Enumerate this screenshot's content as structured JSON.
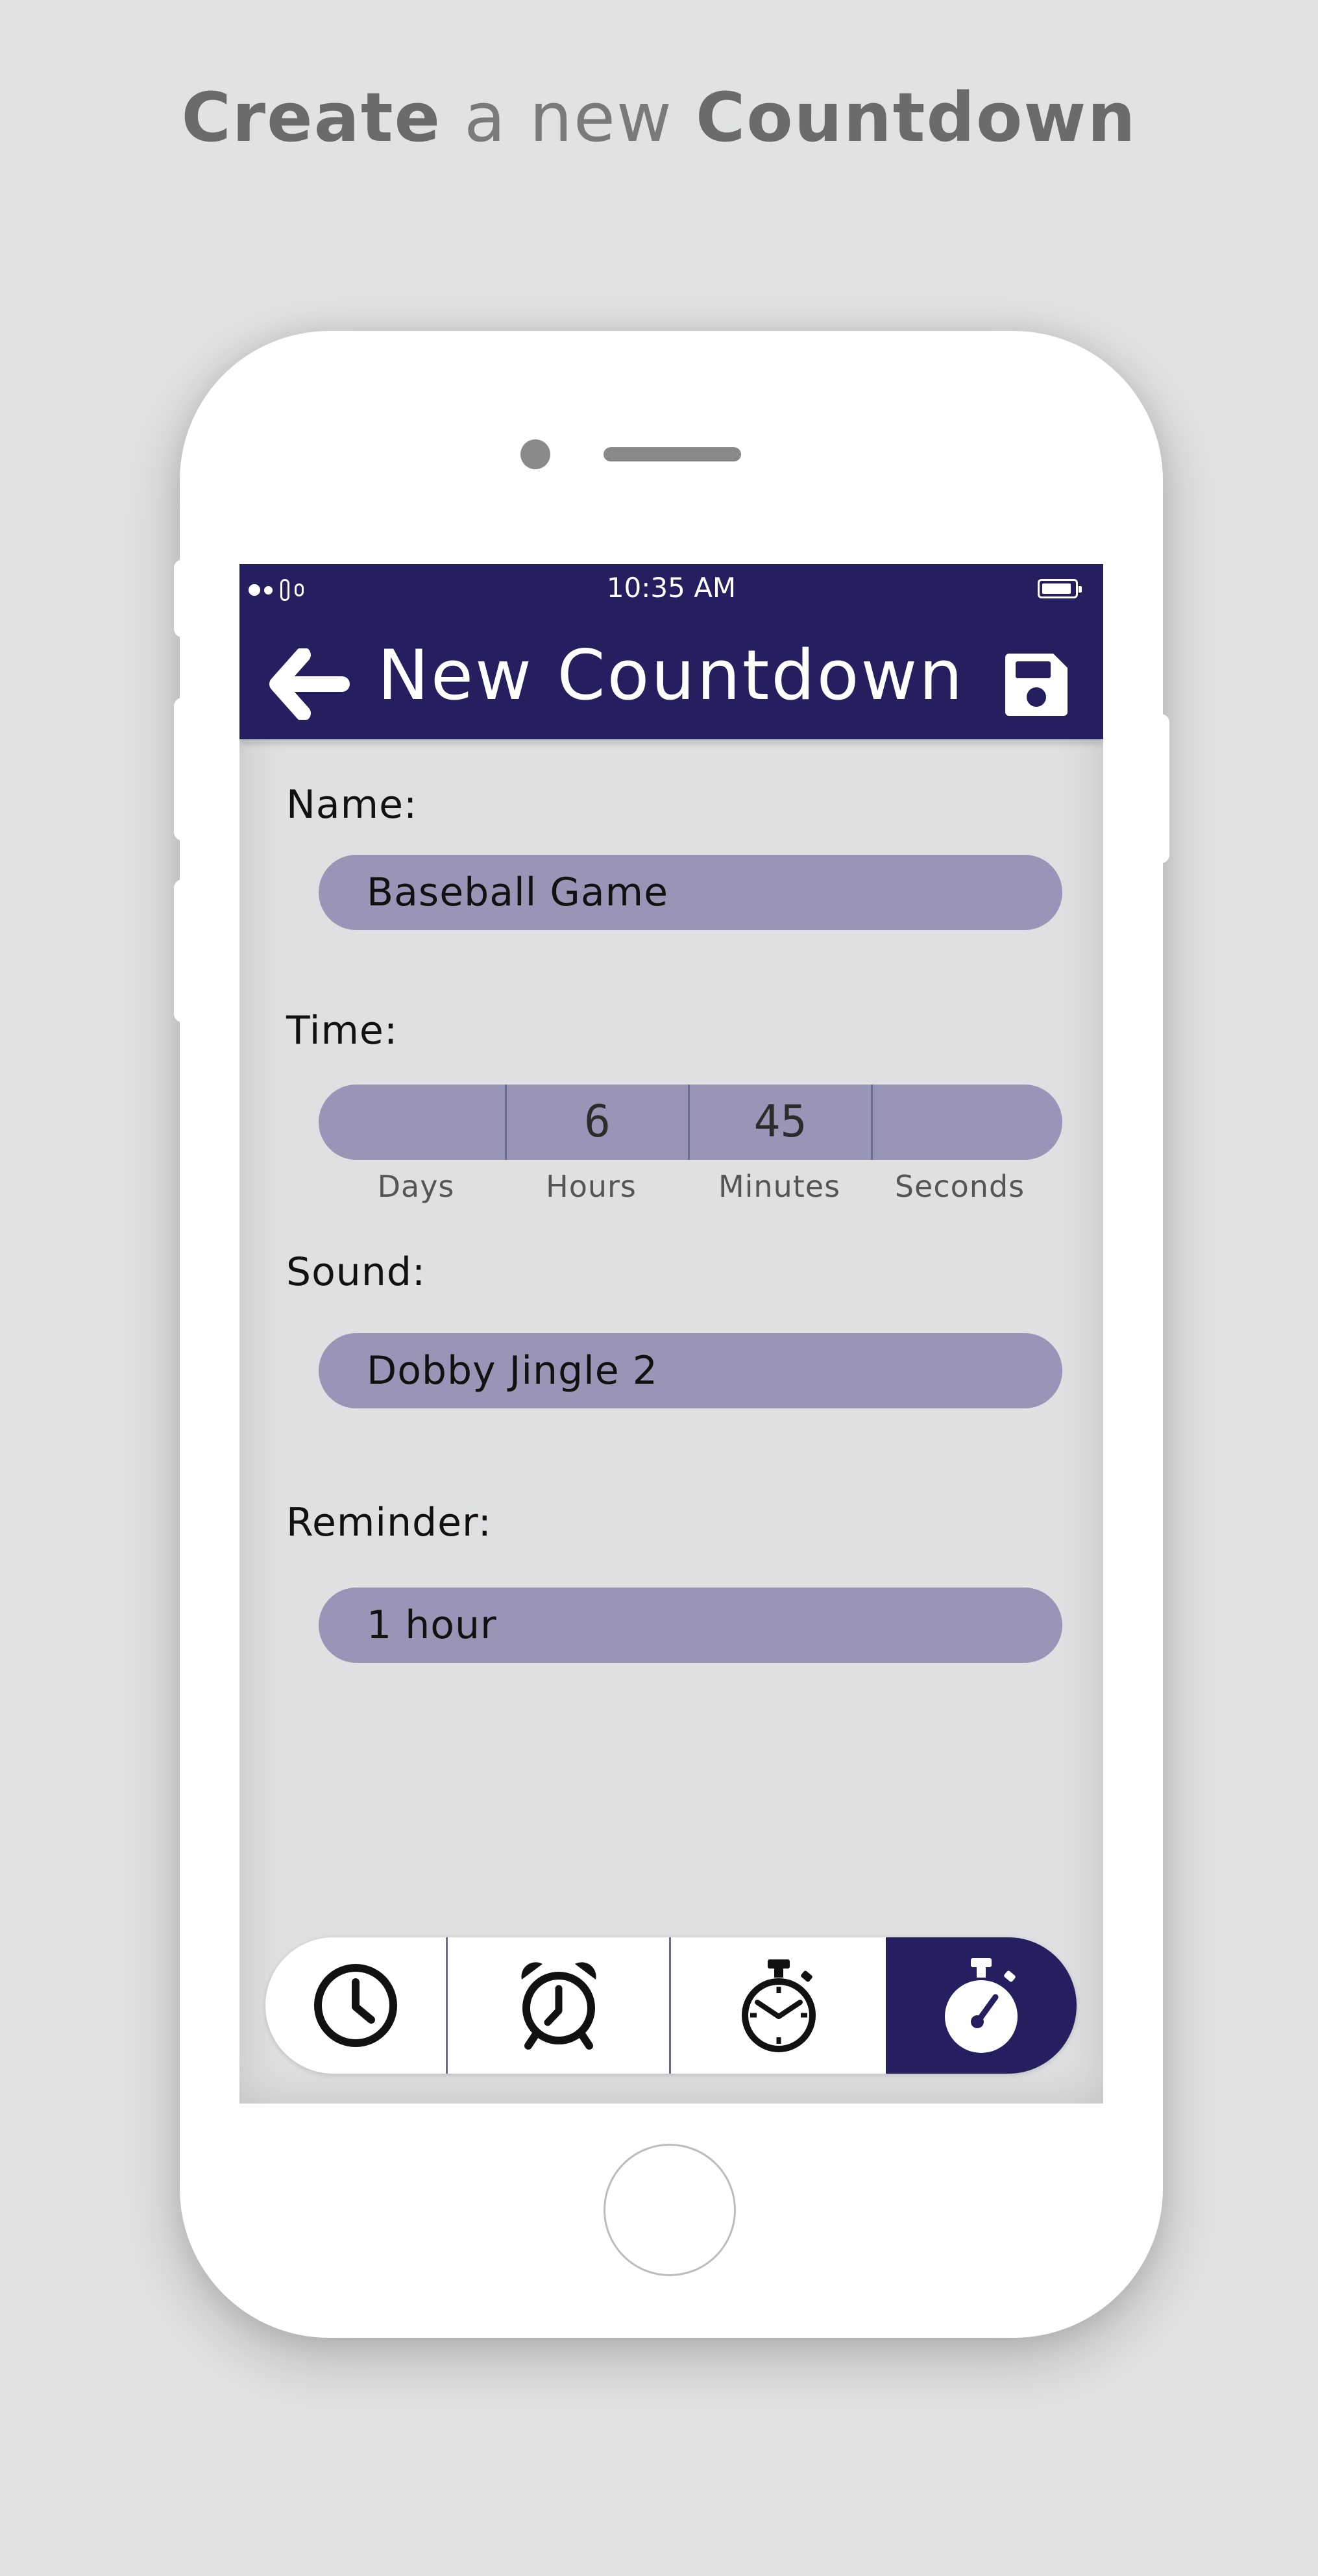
{
  "headline": {
    "word1": "Create",
    "word2": "a new",
    "word3": "Countdown"
  },
  "status_bar": {
    "time": "10:35 AM"
  },
  "app_bar": {
    "title": "New Countdown"
  },
  "form": {
    "name": {
      "label": "Name:",
      "value": "Baseball Game"
    },
    "time": {
      "label": "Time:",
      "days": {
        "caption": "Days",
        "value": ""
      },
      "hours": {
        "caption": "Hours",
        "value": "6"
      },
      "minutes": {
        "caption": "Minutes",
        "value": "45"
      },
      "seconds": {
        "caption": "Seconds",
        "value": ""
      }
    },
    "sound": {
      "label": "Sound:",
      "value": "Dobby Jingle 2"
    },
    "reminder": {
      "label": "Reminder:",
      "value": "1 hour"
    }
  },
  "tab_bar": {
    "tabs": [
      {
        "icon": "clock-icon",
        "active": false
      },
      {
        "icon": "alarm-clock-icon",
        "active": false
      },
      {
        "icon": "stopwatch-icon",
        "active": false
      },
      {
        "icon": "timer-icon",
        "active": true
      }
    ]
  },
  "colors": {
    "background": "#e1e2e3",
    "app_bar": "#251f60",
    "input_pill": "#9895b6",
    "screen": "#dfe0e1",
    "phone_body": "#ffffff"
  }
}
